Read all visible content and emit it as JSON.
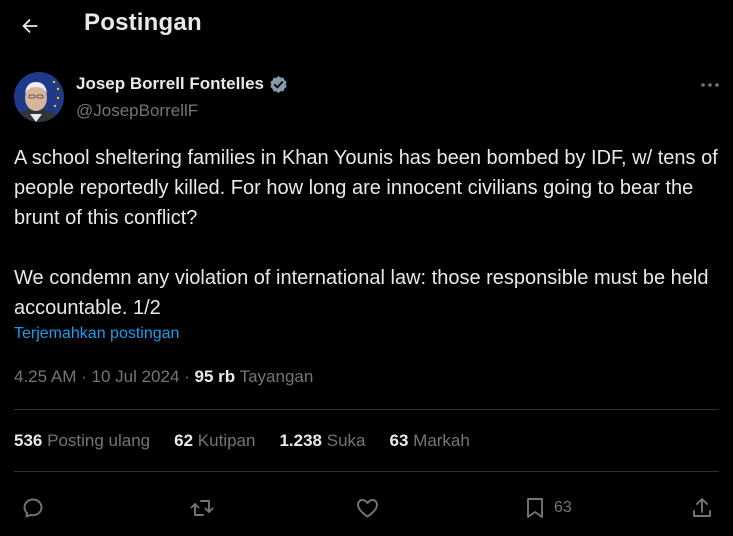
{
  "header": {
    "title": "Postingan"
  },
  "author": {
    "display_name": "Josep Borrell Fontelles",
    "handle": "@JosepBorrellF"
  },
  "tweet": {
    "text": "A school sheltering families in Khan Younis has been bombed by IDF, w/ tens of people reportedly killed. For how long are innocent civilians going to bear the brunt of this conflict?\n\nWe condemn any violation of international law: those responsible must be held accountable. 1/2",
    "translate_label": "Terjemahkan postingan",
    "time": "4.25 AM",
    "date": "10 Jul 2024",
    "views_count": "95 rb",
    "views_label": "Tayangan"
  },
  "stats": {
    "reposts_count": "536",
    "reposts_label": "Posting ulang",
    "quotes_count": "62",
    "quotes_label": "Kutipan",
    "likes_count": "1.238",
    "likes_label": "Suka",
    "bookmarks_count": "63",
    "bookmarks_label": "Markah"
  },
  "actions": {
    "bookmark_count": "63"
  },
  "colors": {
    "background": "#000000",
    "text": "#e7e9ea",
    "muted": "#71767b",
    "link": "#1d9bf0",
    "divider": "#2f3336"
  },
  "icons": [
    "back-arrow-icon",
    "verified-badge-icon",
    "more-icon",
    "reply-icon",
    "retweet-icon",
    "like-icon",
    "bookmark-icon",
    "share-icon"
  ]
}
